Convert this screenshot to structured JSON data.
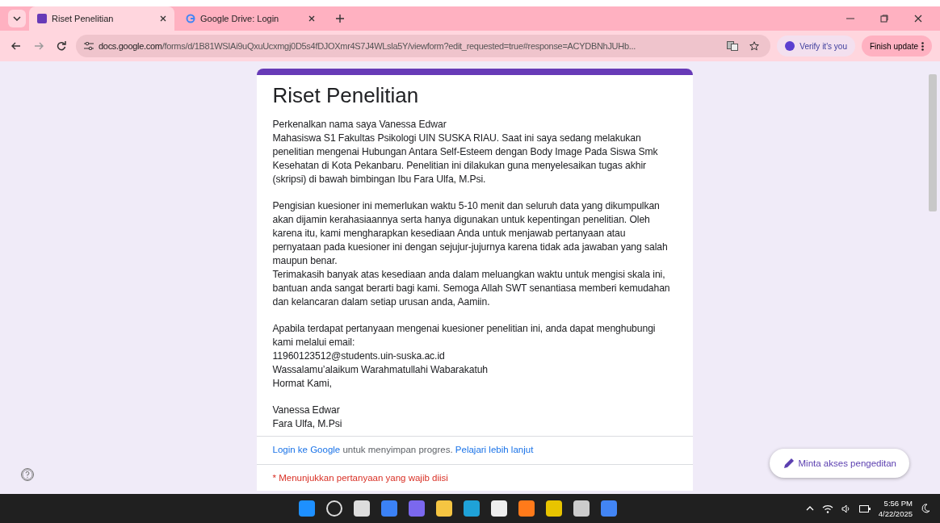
{
  "tabs": [
    {
      "title": "Riset Penelitian",
      "kind": "forms",
      "selected": true
    },
    {
      "title": "Google Drive: Login",
      "kind": "google",
      "selected": false
    }
  ],
  "address_bar": {
    "url_host": "docs.google.com",
    "url_path": "/forms/d/1B81WSIAi9uQxuUcxmgj0D5s4fDJOXmr4S7J4WLsla5Y/viewform?edit_requested=true#response=ACYDBNhJUHb..."
  },
  "toolbar": {
    "verify": "Verify it's you",
    "update": "Finish update"
  },
  "form": {
    "title": "Riset Penelitian",
    "description": [
      "Perkenalkan nama saya Vanessa Edwar\nMahasiswa S1 Fakultas Psikologi UIN SUSKA RIAU. Saat ini saya sedang melakukan penelitian mengenai Hubungan Antara Self-Esteem dengan Body Image Pada Siswa Smk Kesehatan di Kota Pekanbaru. Penelitian ini dilakukan guna menyelesaikan tugas akhir (skripsi) di bawah bimbingan Ibu Fara Ulfa, M.Psi.",
      "Pengisian kuesioner ini memerlukan waktu 5-10 menit dan seluruh data yang dikumpulkan akan dijamin kerahasiaannya serta hanya digunakan untuk kepentingan penelitian. Oleh karena itu, kami mengharapkan kesediaan Anda untuk menjawab pertanyaan atau pernyataan pada kuesioner ini dengan sejujur-jujurnya karena tidak ada jawaban yang salah maupun benar.\nTerimakasih banyak atas kesediaan anda dalam meluangkan waktu untuk mengisi skala ini, bantuan anda sangat berarti bagi kami. Semoga Allah SWT senantiasa memberi kemudahan dan kelancaran dalam setiap urusan anda, Aamiin.",
      "Apabila terdapat pertanyaan mengenai kuesioner penelitian ini, anda dapat menghubungi kami melalui email:\n11960123512@students.uin-suska.ac.id\nWassalamu’alaikum Warahmatullahi Wabarakatuh\nHormat Kami,",
      "Vanessa Edwar\nFara Ulfa, M.Psi"
    ],
    "login_link": "Login ke Google",
    "login_text": " untuk menyimpan progres. ",
    "learn_link": "Pelajari lebih lanjut",
    "required_note": "* Menunjukkan pertanyaan yang wajib diisi"
  },
  "edit_request_button": "Minta akses pengeditan",
  "taskbar": {
    "time": "5:56 PM",
    "date": "4/22/2025"
  }
}
